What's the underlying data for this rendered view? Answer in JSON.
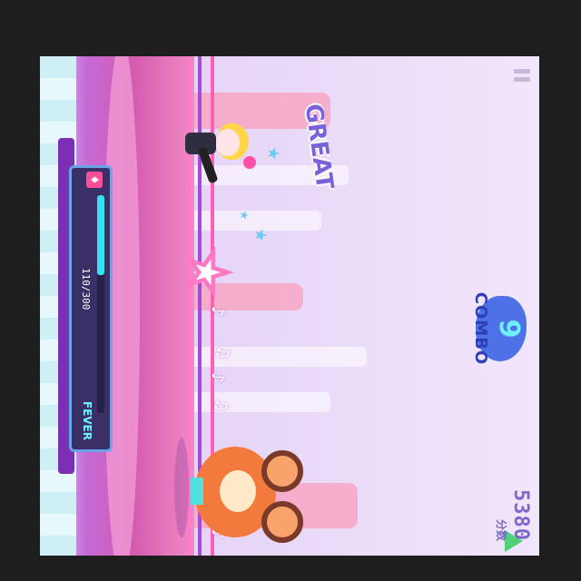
{
  "hud": {
    "score_value": "5380",
    "score_label": "分数",
    "combo_count": "9",
    "combo_label": "COMBO",
    "judgement": "GREAT",
    "pause_icon": "pause-icon"
  },
  "fever": {
    "current": 110,
    "max": 300,
    "count_text": "110/300",
    "label": "FEVER",
    "heart_glyph": "♦"
  },
  "notes": [
    "♪",
    "♫",
    "♪",
    "♫",
    "♪"
  ],
  "colors": {
    "lane_pink": "#ff5fb8",
    "lane_purple": "#a24cd8",
    "fever_fill": "#34e3f0",
    "combo_text": "#6ff0ff",
    "judgement_text": "#7a63d8"
  }
}
